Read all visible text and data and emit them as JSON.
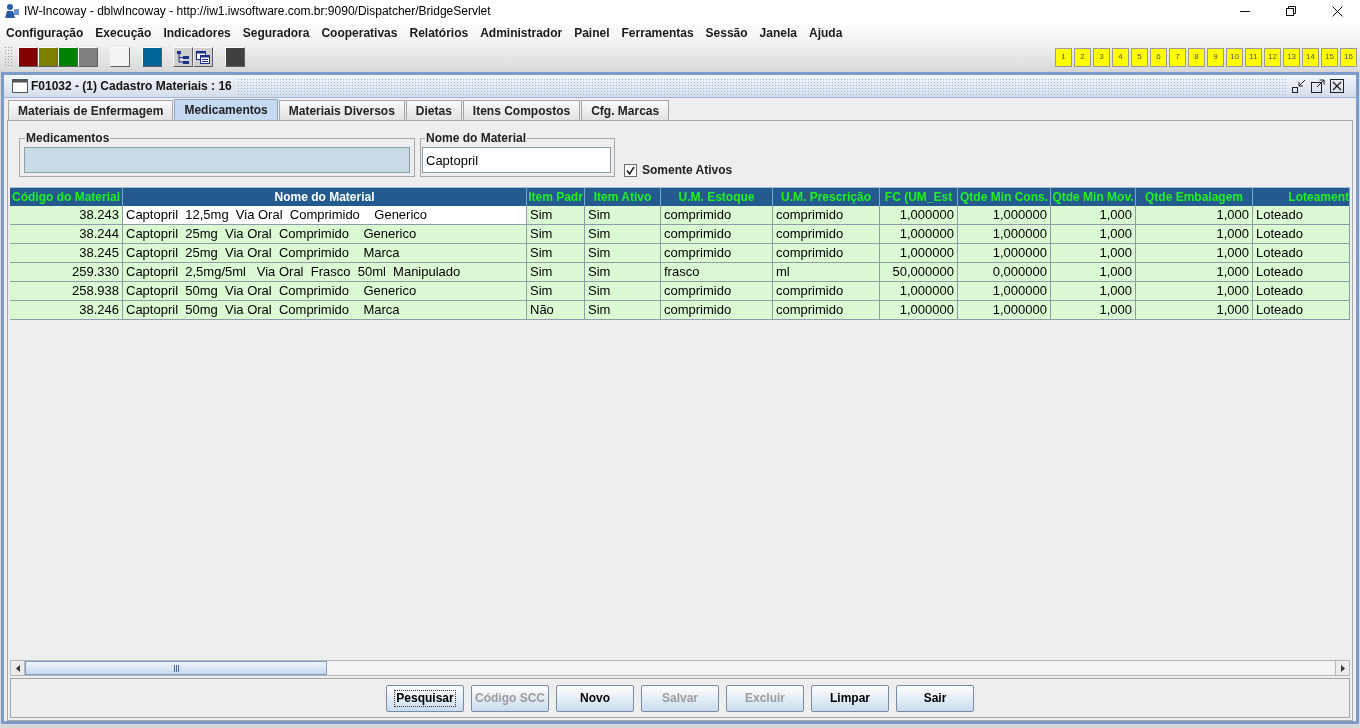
{
  "window": {
    "title": "IW-Incoway - dblwIncoway - http://iw1.iwsoftware.com.br:9090/Dispatcher/BridgeServlet"
  },
  "menu_bar": [
    "Configuração",
    "Execução",
    "Indicadores",
    "Seguradora",
    "Cooperativas",
    "Relatórios",
    "Administrador",
    "Painel",
    "Ferramentas",
    "Sessão",
    "Janela",
    "Ajuda"
  ],
  "toolbar": {
    "groups": [
      {
        "items": [
          {
            "kind": "swatch",
            "color": "#800000"
          },
          {
            "kind": "swatch",
            "color": "#808000"
          },
          {
            "kind": "swatch",
            "color": "#008000"
          },
          {
            "kind": "swatch",
            "color": "#808080"
          }
        ]
      },
      {
        "items": [
          {
            "kind": "swatch",
            "color": "#f2f2f2"
          }
        ]
      },
      {
        "items": [
          {
            "kind": "swatch",
            "color": "#00669a"
          }
        ]
      },
      {
        "items": [
          {
            "kind": "tree"
          },
          {
            "kind": "windows"
          }
        ]
      },
      {
        "items": [
          {
            "kind": "swatch",
            "color": "#404040"
          }
        ]
      }
    ],
    "numbered_buttons": [
      "1",
      "2",
      "3",
      "4",
      "5",
      "6",
      "7",
      "8",
      "9",
      "10",
      "11",
      "12",
      "13",
      "14",
      "15",
      "16"
    ]
  },
  "internal_frame": {
    "title": "F01032 - (1) Cadastro Materiais : 16",
    "tabs": [
      {
        "label": "Materiais de Enfermagem",
        "selected": false
      },
      {
        "label": "Medicamentos",
        "selected": true
      },
      {
        "label": "Materiais Diversos",
        "selected": false
      },
      {
        "label": "Dietas",
        "selected": false
      },
      {
        "label": "Itens Compostos",
        "selected": false
      },
      {
        "label": "Cfg. Marcas",
        "selected": false
      }
    ],
    "filters": [
      {
        "legend": "Medicamentos",
        "readonly": true
      },
      {
        "legend": "Nome do Material",
        "value": "Captopril",
        "readonly": false
      }
    ],
    "checkbox": {
      "label": "Somente Ativos",
      "checked": true
    },
    "table": {
      "columns": [
        {
          "label": "Código do Material",
          "kind": "number",
          "highlighted": true
        },
        {
          "label": "Nome do Material",
          "kind": "text",
          "highlighted": false
        },
        {
          "label": "Item Padr",
          "kind": "text",
          "highlighted": true
        },
        {
          "label": "Item Ativo",
          "kind": "text",
          "highlighted": true
        },
        {
          "label": "U.M. Estoque",
          "kind": "text",
          "highlighted": true
        },
        {
          "label": "U.M. Prescrição",
          "kind": "text",
          "highlighted": true
        },
        {
          "label": "FC (UM_Est",
          "kind": "number",
          "highlighted": true
        },
        {
          "label": "Qtde Min Cons.",
          "kind": "number",
          "highlighted": true
        },
        {
          "label": "Qtde Min Mov.",
          "kind": "number",
          "highlighted": true
        },
        {
          "label": "Qtde Embalagem",
          "kind": "number",
          "highlighted": true
        },
        {
          "label": "Loteament",
          "kind": "text",
          "highlighted": true
        }
      ],
      "rows": [
        {
          "focused": true,
          "cells": [
            "38.243",
            "Captopril  12,5mg  Via Oral  Comprimido    Generico",
            "Sim",
            "Sim",
            "comprimido",
            "comprimido",
            "1,000000",
            "1,000000",
            "1,000",
            "1,000",
            "Loteado"
          ]
        },
        {
          "focused": false,
          "cells": [
            "38.244",
            "Captopril  25mg  Via Oral  Comprimido    Generico",
            "Sim",
            "Sim",
            "comprimido",
            "comprimido",
            "1,000000",
            "1,000000",
            "1,000",
            "1,000",
            "Loteado"
          ]
        },
        {
          "focused": false,
          "cells": [
            "38.245",
            "Captopril  25mg  Via Oral  Comprimido    Marca",
            "Sim",
            "Sim",
            "comprimido",
            "comprimido",
            "1,000000",
            "1,000000",
            "1,000",
            "1,000",
            "Loteado"
          ]
        },
        {
          "focused": false,
          "cells": [
            "259.330",
            "Captopril  2,5mg/5ml   Via Oral  Frasco  50ml  Manipulado",
            "Sim",
            "Sim",
            "frasco",
            "ml",
            "50,000000",
            "0,000000",
            "1,000",
            "1,000",
            "Loteado"
          ]
        },
        {
          "focused": false,
          "cells": [
            "258.938",
            "Captopril  50mg  Via Oral  Comprimido    Generico",
            "Sim",
            "Sim",
            "comprimido",
            "comprimido",
            "1,000000",
            "1,000000",
            "1,000",
            "1,000",
            "Loteado"
          ]
        },
        {
          "focused": false,
          "cells": [
            "38.246",
            "Captopril  50mg  Via Oral  Comprimido    Marca",
            "Não",
            "Sim",
            "comprimido",
            "comprimido",
            "1,000000",
            "1,000000",
            "1,000",
            "1,000",
            "Loteado"
          ]
        }
      ]
    },
    "buttons": [
      {
        "label": "Pesquisar",
        "disabled": false,
        "focused": true
      },
      {
        "label": "Código SCC",
        "disabled": true,
        "focused": false
      },
      {
        "label": "Novo",
        "disabled": false,
        "focused": false
      },
      {
        "label": "Salvar",
        "disabled": true,
        "focused": false
      },
      {
        "label": "Excluir",
        "disabled": true,
        "focused": false
      },
      {
        "label": "Limpar",
        "disabled": false,
        "focused": false
      },
      {
        "label": "Sair",
        "disabled": false,
        "focused": false
      }
    ]
  }
}
